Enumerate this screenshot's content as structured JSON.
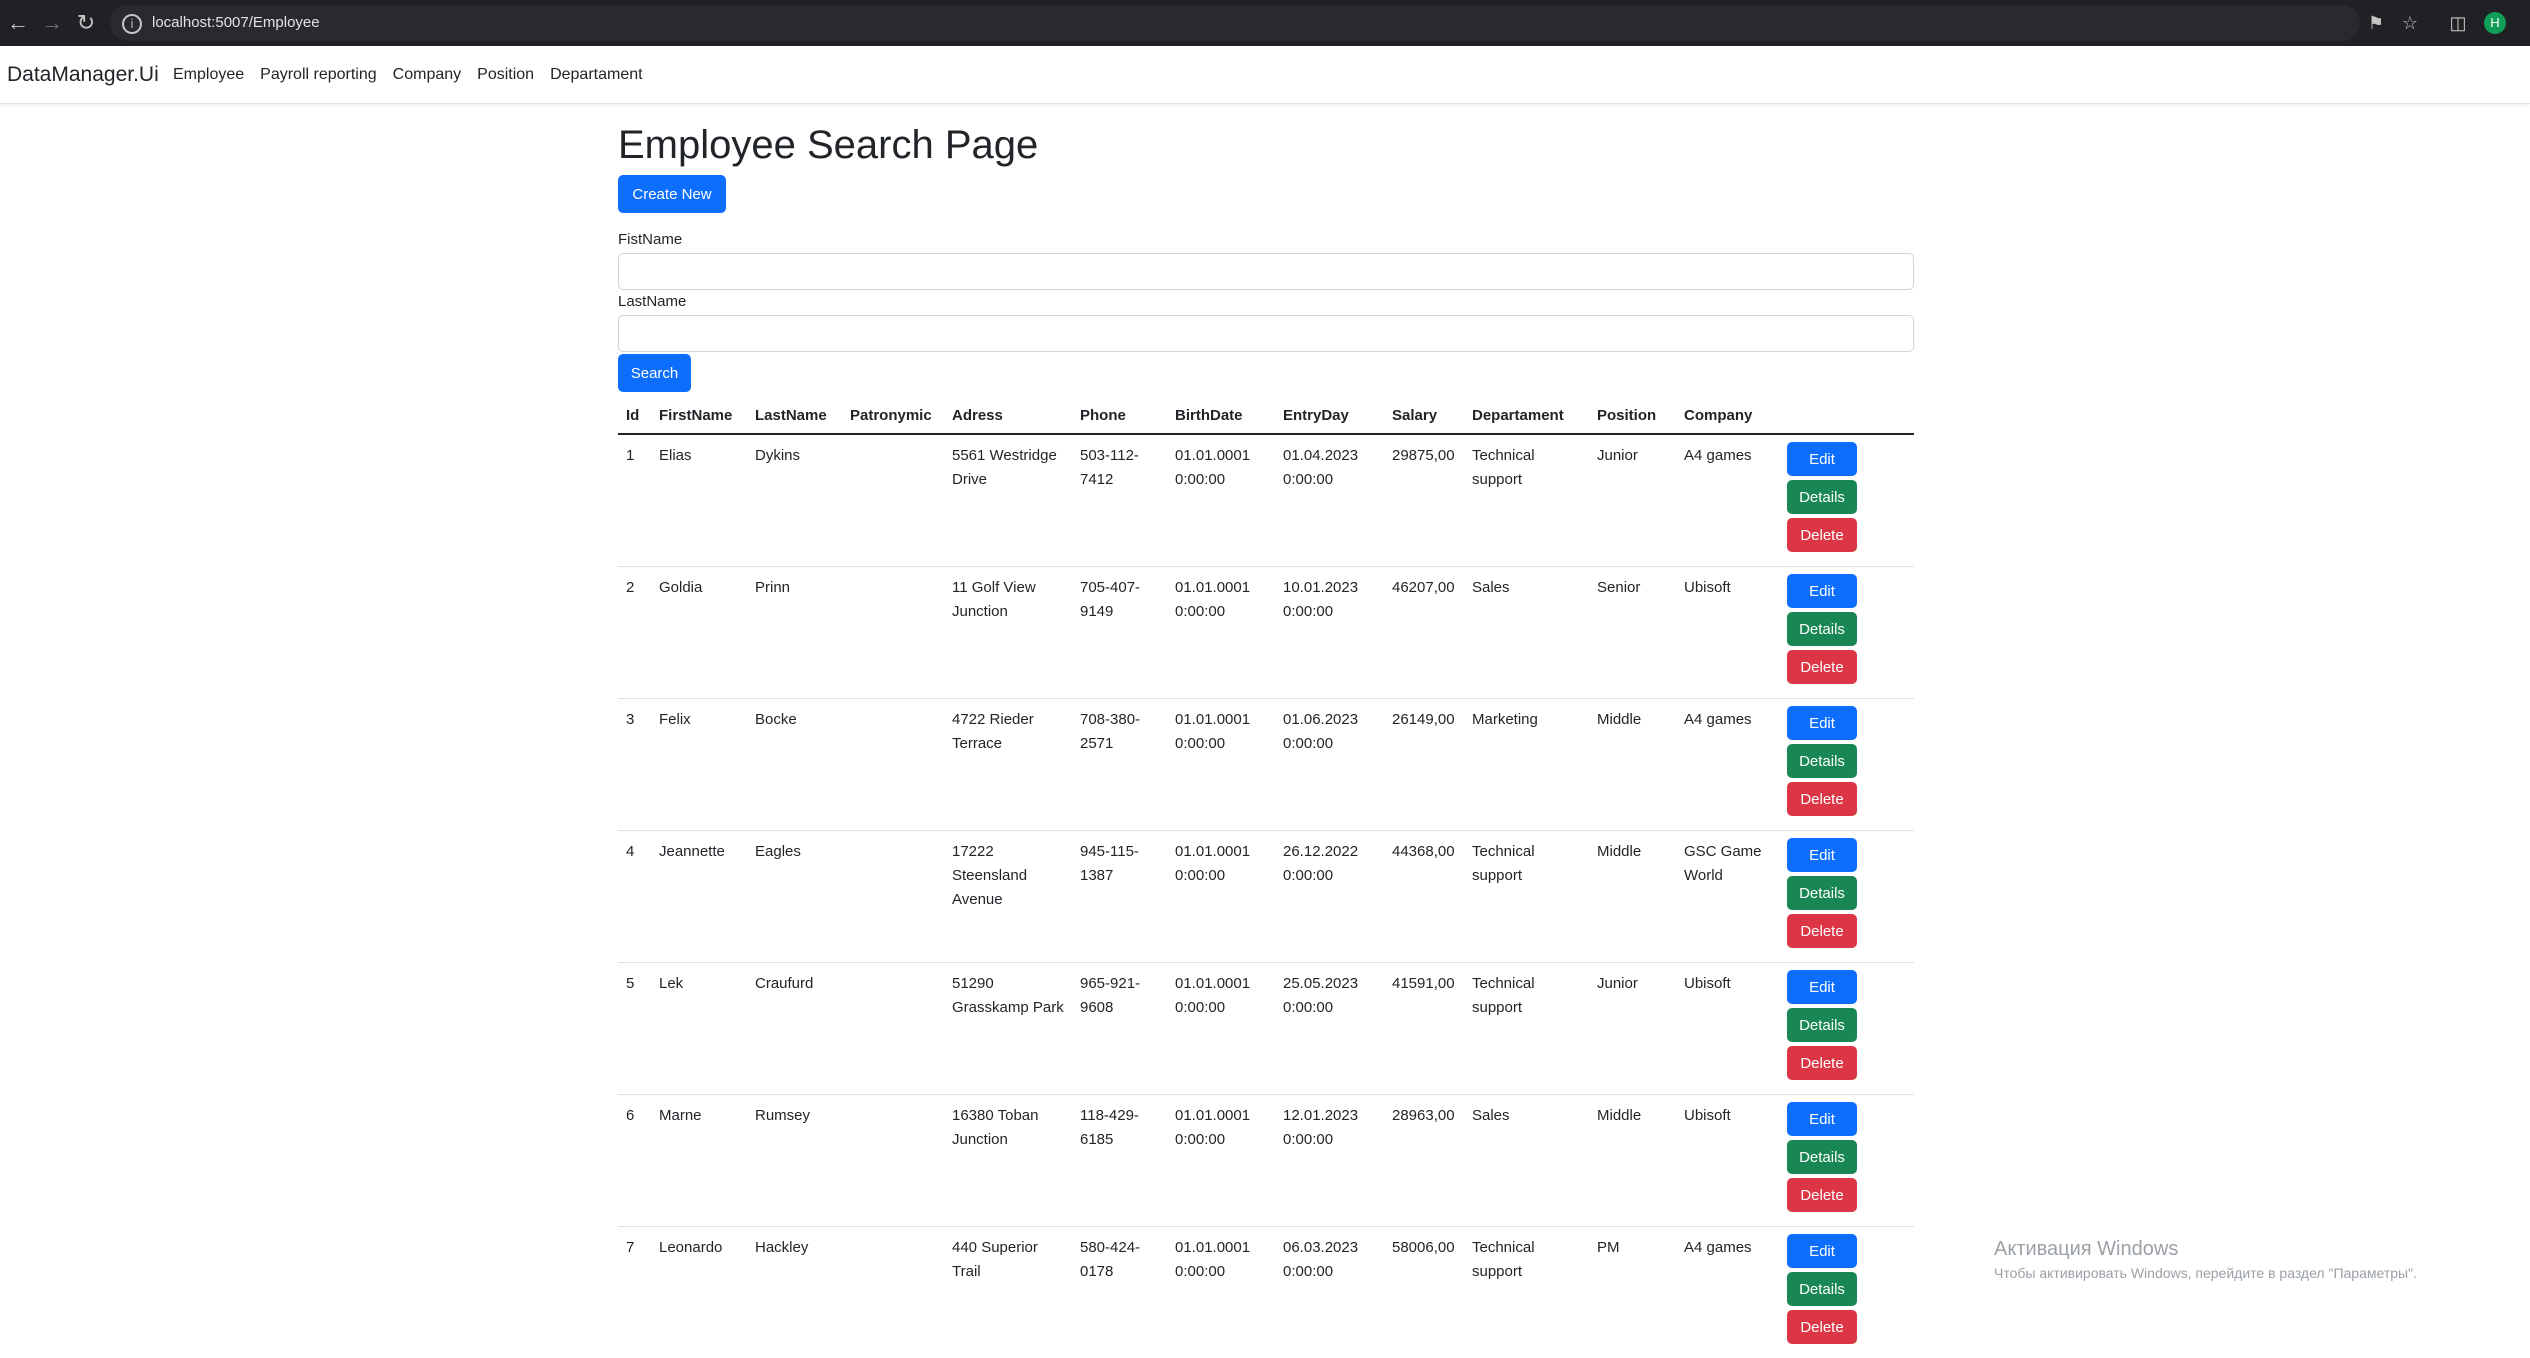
{
  "browser": {
    "url": "localhost:5007/Employee",
    "profile_initial": "H"
  },
  "navbar": {
    "brand": "DataManager.Ui",
    "links": [
      "Employee",
      "Payroll reporting",
      "Company",
      "Position",
      "Departament"
    ]
  },
  "page": {
    "title": "Employee Search Page",
    "create_label": "Create New",
    "first_name_label": "FistName",
    "first_name_value": "",
    "last_name_label": "LastName",
    "last_name_value": "",
    "search_label": "Search"
  },
  "table": {
    "headers": [
      "Id",
      "FirstName",
      "LastName",
      "Patronymic",
      "Adress",
      "Phone",
      "BirthDate",
      "EntryDay",
      "Salary",
      "Departament",
      "Position",
      "Company",
      ""
    ],
    "action_labels": {
      "edit": "Edit",
      "details": "Details",
      "delete": "Delete"
    },
    "rows": [
      {
        "id": "1",
        "first": "Elias",
        "last": "Dykins",
        "patronymic": "",
        "address": "5561 Westridge Drive",
        "phone": "503-112-7412",
        "birth": "01.01.0001 0:00:00",
        "entry": "01.04.2023 0:00:00",
        "salary": "29875,00",
        "dept": "Technical support",
        "position": "Junior",
        "company": "A4 games"
      },
      {
        "id": "2",
        "first": "Goldia",
        "last": "Prinn",
        "patronymic": "",
        "address": "11 Golf View Junction",
        "phone": "705-407-9149",
        "birth": "01.01.0001 0:00:00",
        "entry": "10.01.2023 0:00:00",
        "salary": "46207,00",
        "dept": "Sales",
        "position": "Senior",
        "company": "Ubisoft"
      },
      {
        "id": "3",
        "first": "Felix",
        "last": "Bocke",
        "patronymic": "",
        "address": "4722 Rieder Terrace",
        "phone": "708-380-2571",
        "birth": "01.01.0001 0:00:00",
        "entry": "01.06.2023 0:00:00",
        "salary": "26149,00",
        "dept": "Marketing",
        "position": "Middle",
        "company": "A4 games"
      },
      {
        "id": "4",
        "first": "Jeannette",
        "last": "Eagles",
        "patronymic": "",
        "address": "17222 Steensland Avenue",
        "phone": "945-115-1387",
        "birth": "01.01.0001 0:00:00",
        "entry": "26.12.2022 0:00:00",
        "salary": "44368,00",
        "dept": "Technical support",
        "position": "Middle",
        "company": "GSC Game World"
      },
      {
        "id": "5",
        "first": "Lek",
        "last": "Craufurd",
        "patronymic": "",
        "address": "51290 Grasskamp Park",
        "phone": "965-921-9608",
        "birth": "01.01.0001 0:00:00",
        "entry": "25.05.2023 0:00:00",
        "salary": "41591,00",
        "dept": "Technical support",
        "position": "Junior",
        "company": "Ubisoft"
      },
      {
        "id": "6",
        "first": "Marne",
        "last": "Rumsey",
        "patronymic": "",
        "address": "16380 Toban Junction",
        "phone": "118-429-6185",
        "birth": "01.01.0001 0:00:00",
        "entry": "12.01.2023 0:00:00",
        "salary": "28963,00",
        "dept": "Sales",
        "position": "Middle",
        "company": "Ubisoft"
      },
      {
        "id": "7",
        "first": "Leonardo",
        "last": "Hackley",
        "patronymic": "",
        "address": "440 Superior Trail",
        "phone": "580-424-0178",
        "birth": "01.01.0001 0:00:00",
        "entry": "06.03.2023 0:00:00",
        "salary": "58006,00",
        "dept": "Technical support",
        "position": "PM",
        "company": "A4 games"
      }
    ]
  },
  "watermark": {
    "line1": "Активация Windows",
    "line2": "Чтобы активировать Windows, перейдите в раздел \"Параметры\"."
  }
}
